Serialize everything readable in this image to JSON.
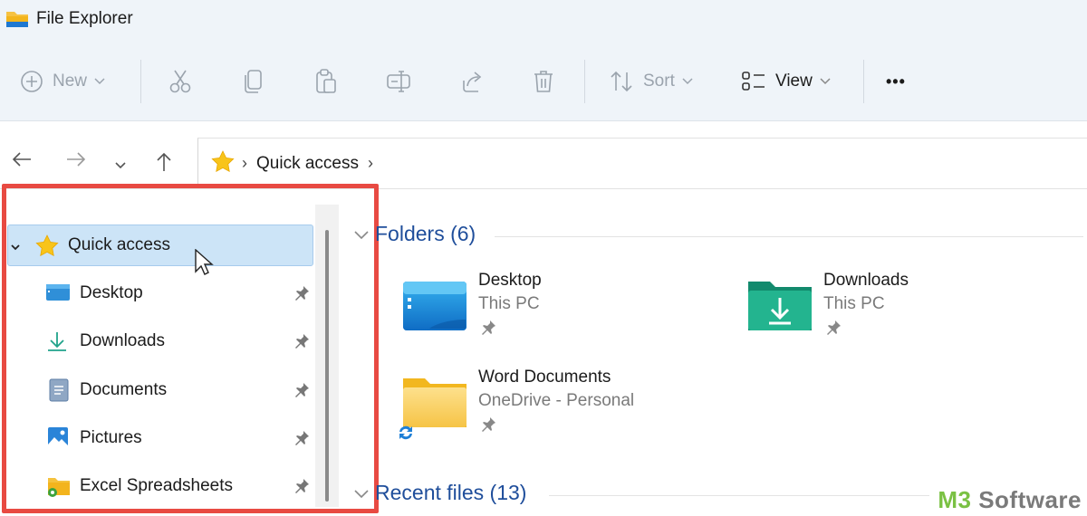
{
  "window": {
    "title": "File Explorer"
  },
  "toolbar": {
    "new_label": "New",
    "sort_label": "Sort",
    "view_label": "View",
    "more_label": "•••"
  },
  "address": {
    "crumbs": [
      "Quick access"
    ],
    "chevron": "›"
  },
  "sidebar": {
    "items": [
      {
        "label": "Quick access",
        "icon": "star-icon",
        "selected": true,
        "expanded": true
      },
      {
        "label": "Desktop",
        "icon": "desktop-folder-icon",
        "pinned": true
      },
      {
        "label": "Downloads",
        "icon": "download-icon",
        "pinned": true
      },
      {
        "label": "Documents",
        "icon": "documents-icon",
        "pinned": true
      },
      {
        "label": "Pictures",
        "icon": "pictures-icon",
        "pinned": true
      },
      {
        "label": "Excel Spreadsheets",
        "icon": "excel-folder-icon",
        "pinned": true
      }
    ]
  },
  "main": {
    "folders_header": "Folders (6)",
    "recent_header": "Recent files (13)",
    "folders": [
      {
        "name": "Desktop",
        "location": "This PC",
        "icon": "desktop-folder-icon"
      },
      {
        "name": "Downloads",
        "location": "This PC",
        "icon": "downloads-folder-icon"
      },
      {
        "name": "Word Documents",
        "location": "OneDrive - Personal",
        "icon": "folder-icon"
      }
    ]
  },
  "watermark": {
    "brand": "M3",
    "rest": " Software"
  },
  "colors": {
    "accent": "#1f4e9b",
    "highlight": "#e84a42",
    "selection": "#cce4f7"
  }
}
